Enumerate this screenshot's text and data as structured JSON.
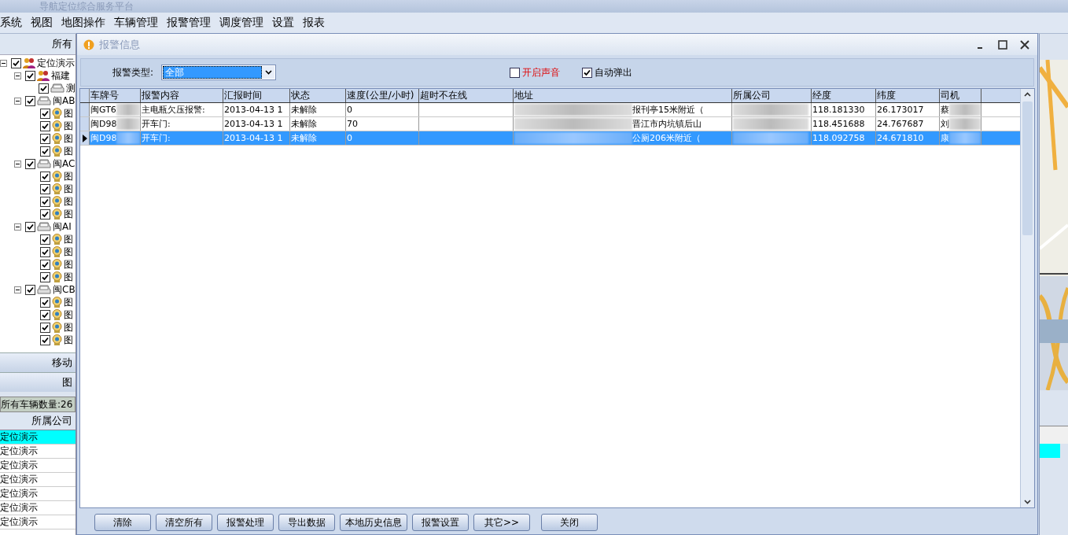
{
  "app": {
    "title": "导航定位综合服务平台"
  },
  "menu": [
    "系统",
    "视图",
    "地图操作",
    "车辆管理",
    "报警管理",
    "调度管理",
    "设置",
    "报表"
  ],
  "left_panel": {
    "header": "所有",
    "tree": [
      {
        "label": "定位演示",
        "kind": "group",
        "checked": true,
        "expanded": true,
        "children": [
          {
            "label": "福建",
            "kind": "group",
            "checked": true,
            "expanded": true,
            "children": [
              {
                "label": "测",
                "kind": "car",
                "checked": true
              }
            ]
          },
          {
            "label": "闽AB",
            "kind": "car",
            "checked": true,
            "expanded": true,
            "children": [
              {
                "label": "图",
                "kind": "camera",
                "checked": true
              },
              {
                "label": "图",
                "kind": "camera",
                "checked": true
              },
              {
                "label": "图",
                "kind": "camera",
                "checked": true
              },
              {
                "label": "图",
                "kind": "camera",
                "checked": true
              }
            ]
          },
          {
            "label": "闽AC",
            "kind": "car",
            "checked": true,
            "expanded": true,
            "children": [
              {
                "label": "图",
                "kind": "camera",
                "checked": true
              },
              {
                "label": "图",
                "kind": "camera",
                "checked": true
              },
              {
                "label": "图",
                "kind": "camera",
                "checked": true
              },
              {
                "label": "图",
                "kind": "camera",
                "checked": true
              }
            ]
          },
          {
            "label": "闽AI",
            "kind": "car",
            "checked": true,
            "expanded": true,
            "children": [
              {
                "label": "图",
                "kind": "camera",
                "checked": true
              },
              {
                "label": "图",
                "kind": "camera",
                "checked": true
              },
              {
                "label": "图",
                "kind": "camera",
                "checked": true
              },
              {
                "label": "图",
                "kind": "camera",
                "checked": true
              }
            ]
          },
          {
            "label": "闽CB",
            "kind": "car",
            "checked": true,
            "expanded": true,
            "children": [
              {
                "label": "图",
                "kind": "camera",
                "checked": true
              },
              {
                "label": "图",
                "kind": "camera",
                "checked": true
              },
              {
                "label": "图",
                "kind": "camera",
                "checked": true
              },
              {
                "label": "图",
                "kind": "camera",
                "checked": true
              }
            ]
          }
        ]
      }
    ],
    "bars": [
      "移动",
      "图"
    ],
    "count": "所有车辆数量:26",
    "company_column": "所属公司",
    "company_rows": [
      {
        "text": "定位演示",
        "selected": true
      },
      {
        "text": "定位演示",
        "selected": false
      },
      {
        "text": "定位演示",
        "selected": false
      },
      {
        "text": "定位演示",
        "selected": false
      },
      {
        "text": "定位演示",
        "selected": false
      },
      {
        "text": "定位演示",
        "selected": false
      },
      {
        "text": "定位演示",
        "selected": false
      }
    ]
  },
  "dialog": {
    "title": "报警信息",
    "filter": {
      "label": "报警类型:",
      "value": "全部"
    },
    "options": [
      {
        "label": "开启声音",
        "checked": false
      },
      {
        "label": "自动弹出",
        "checked": true
      }
    ],
    "columns": [
      "车牌号",
      "报警内容",
      "汇报时间",
      "状态",
      "速度(公里/小时)",
      "超时不在线",
      "地址",
      "所属公司",
      "经度",
      "纬度",
      "司机"
    ],
    "rows": [
      {
        "selected": false,
        "cells": [
          "闽GT6",
          "主电瓶欠压报警:",
          "2013-04-13 1",
          "未解除",
          "0",
          "",
          "报刊亭15米附近（",
          "",
          "118.181330",
          "26.173017",
          "蔡"
        ]
      },
      {
        "selected": false,
        "cells": [
          "闽D98",
          "开车门:",
          "2013-04-13 1",
          "未解除",
          "70",
          "",
          "晋江市内坑镇后山",
          "",
          "118.451688",
          "24.767687",
          "刘"
        ]
      },
      {
        "selected": true,
        "cells": [
          "闽D98",
          "开车门:",
          "2013-04-13 1",
          "未解除",
          "0",
          "",
          "公厕206米附近（",
          "",
          "118.092758",
          "24.671810",
          "康"
        ]
      }
    ],
    "buttons": [
      "清除",
      "清空所有",
      "报警处理",
      "导出数据",
      "本地历史信息",
      "报警设置",
      "其它>>",
      "关闭"
    ]
  }
}
